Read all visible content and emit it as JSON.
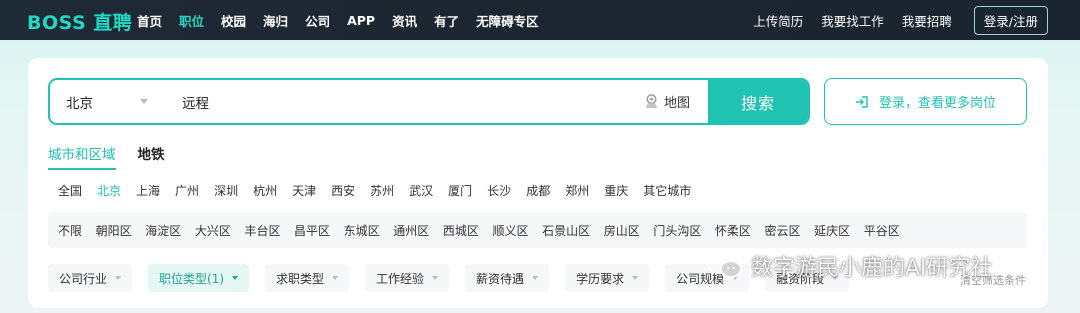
{
  "header": {
    "logo": "BOSS 直聘",
    "nav": [
      "首页",
      "职位",
      "校园",
      "海归",
      "公司",
      "APP",
      "资讯",
      "有了",
      "无障碍专区"
    ],
    "active_nav": 1,
    "right": [
      "上传简历",
      "我要找工作",
      "我要招聘"
    ],
    "login": "登录/注册"
  },
  "search": {
    "city": "北京",
    "query": "远程",
    "map_label": "地图",
    "button": "搜索"
  },
  "login_more": "登录，查看更多岗位",
  "tabs": [
    "城市和区域",
    "地铁"
  ],
  "cities": [
    "全国",
    "北京",
    "上海",
    "广州",
    "深圳",
    "杭州",
    "天津",
    "西安",
    "苏州",
    "武汉",
    "厦门",
    "长沙",
    "成都",
    "郑州",
    "重庆",
    "其它城市"
  ],
  "active_city": 1,
  "districts": [
    "不限",
    "朝阳区",
    "海淀区",
    "大兴区",
    "丰台区",
    "昌平区",
    "东城区",
    "通州区",
    "西城区",
    "顺义区",
    "石景山区",
    "房山区",
    "门头沟区",
    "怀柔区",
    "密云区",
    "延庆区",
    "平谷区"
  ],
  "filters": [
    "公司行业",
    "职位类型(1)",
    "求职类型",
    "工作经验",
    "薪资待遇",
    "学历要求",
    "公司规模",
    "融资阶段"
  ],
  "active_filter": 1,
  "clear": "清空筛选条件",
  "watermark": "数字游民小鹿的AI研究社",
  "colors": {
    "accent": "#20c2b1",
    "logo": "#21d8c3",
    "topbar": "#1e2a36"
  }
}
